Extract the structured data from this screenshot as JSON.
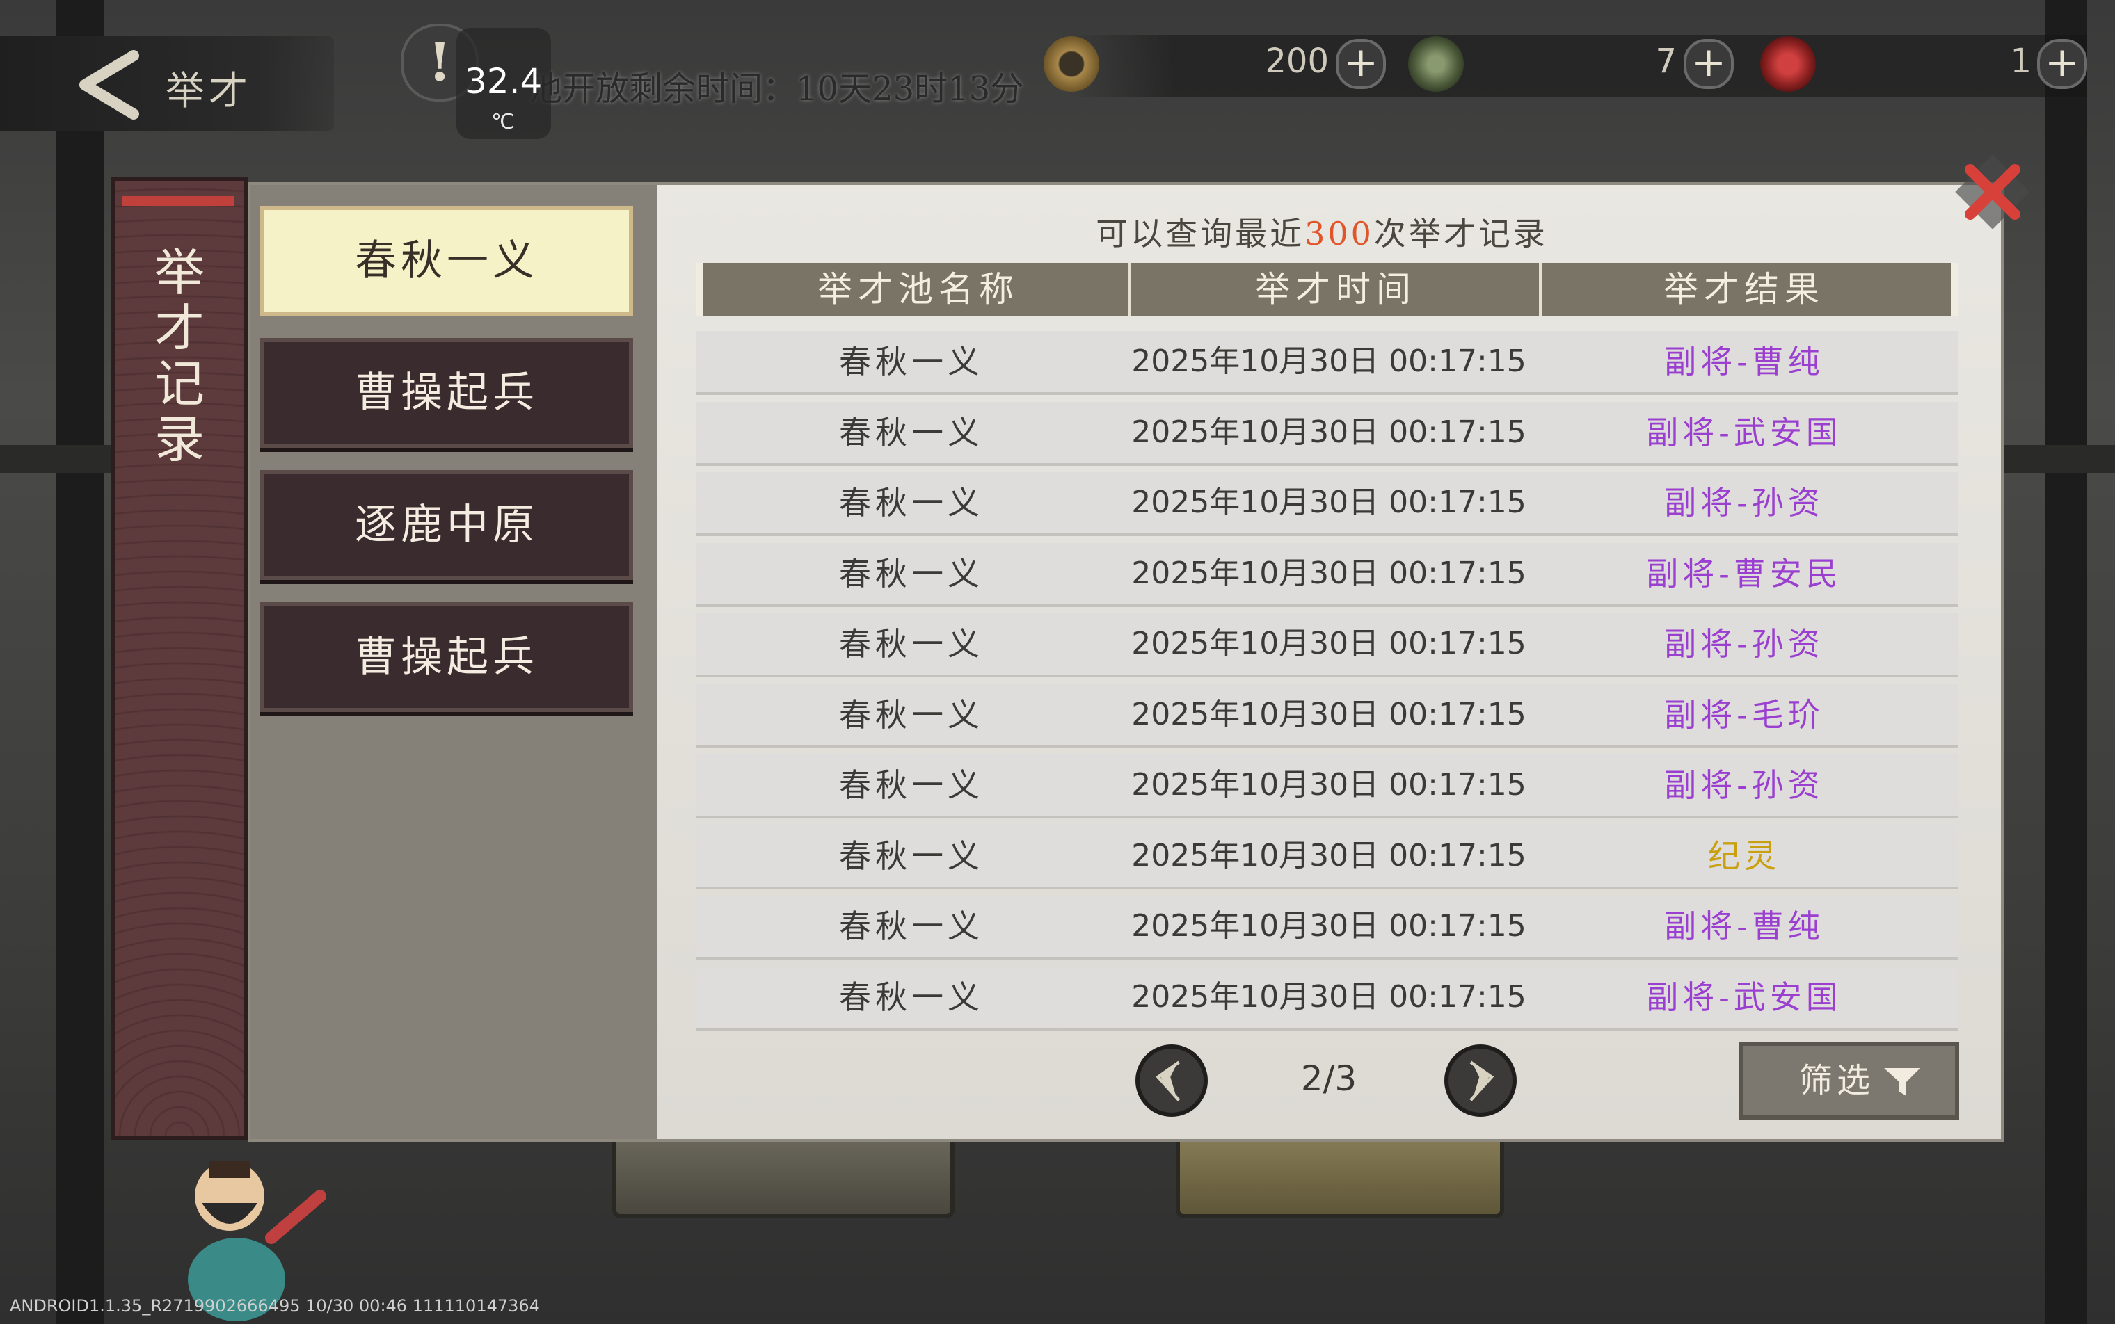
{
  "topbar": {
    "back_title": "举才",
    "temperature": "32.4",
    "temperature_unit": "℃",
    "pool_timer": "池开放剩余时间：10天23时13分",
    "currencies": [
      {
        "icon": "coin-icon",
        "value": "200"
      },
      {
        "icon": "jade-token-icon",
        "value": "7"
      },
      {
        "icon": "red-seal-icon",
        "value": "1"
      }
    ]
  },
  "side_title": "举才记录",
  "pools": [
    {
      "label": "春秋一义",
      "active": true
    },
    {
      "label": "曹操起兵",
      "active": false
    },
    {
      "label": "逐鹿中原",
      "active": false
    },
    {
      "label": "曹操起兵",
      "active": false
    }
  ],
  "notice": {
    "prefix": "可以查询最近",
    "count": "300",
    "suffix": "次举才记录"
  },
  "table": {
    "headers": [
      "举才池名称",
      "举才时间",
      "举才结果"
    ],
    "rows": [
      {
        "pool": "春秋一义",
        "time": "2025年10月30日 00:17:15",
        "result": "副将-曹纯",
        "rarity": "purple"
      },
      {
        "pool": "春秋一义",
        "time": "2025年10月30日 00:17:15",
        "result": "副将-武安国",
        "rarity": "purple"
      },
      {
        "pool": "春秋一义",
        "time": "2025年10月30日 00:17:15",
        "result": "副将-孙资",
        "rarity": "purple"
      },
      {
        "pool": "春秋一义",
        "time": "2025年10月30日 00:17:15",
        "result": "副将-曹安民",
        "rarity": "purple"
      },
      {
        "pool": "春秋一义",
        "time": "2025年10月30日 00:17:15",
        "result": "副将-孙资",
        "rarity": "purple"
      },
      {
        "pool": "春秋一义",
        "time": "2025年10月30日 00:17:15",
        "result": "副将-毛玠",
        "rarity": "purple"
      },
      {
        "pool": "春秋一义",
        "time": "2025年10月30日 00:17:15",
        "result": "副将-孙资",
        "rarity": "purple"
      },
      {
        "pool": "春秋一义",
        "time": "2025年10月30日 00:17:15",
        "result": "纪灵",
        "rarity": "gold"
      },
      {
        "pool": "春秋一义",
        "time": "2025年10月30日 00:17:15",
        "result": "副将-曹纯",
        "rarity": "purple"
      },
      {
        "pool": "春秋一义",
        "time": "2025年10月30日 00:17:15",
        "result": "副将-武安国",
        "rarity": "purple"
      }
    ]
  },
  "pager": {
    "label": "2/3",
    "current": 2,
    "total": 3
  },
  "filter_label": "筛选",
  "colors": {
    "purple": "#9a3fd0",
    "gold": "#c8a010",
    "highlight": "#e0552a"
  },
  "build_info": "ANDROID1.1.35_R2719902666495 10/30 00:46 111110147364"
}
